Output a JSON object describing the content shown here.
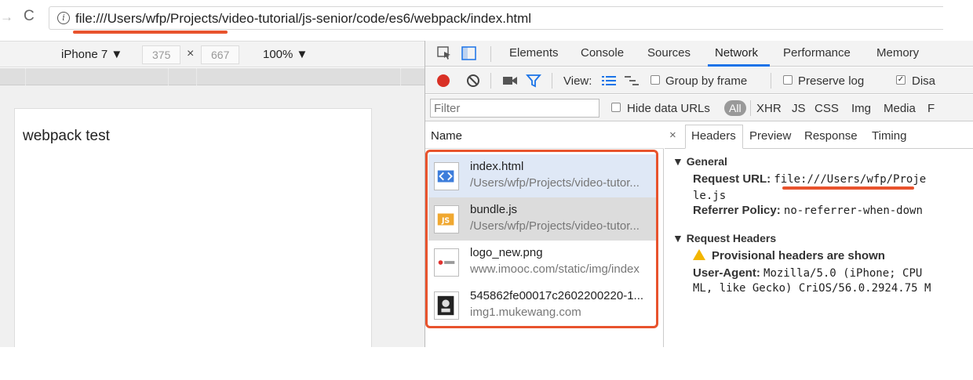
{
  "browser": {
    "back_arrow": "→",
    "reload_glyph": "C",
    "info_glyph": "i",
    "url": "file:///Users/wfp/Projects/video-tutorial/js-senior/code/es6/webpack/index.html"
  },
  "device_toolbar": {
    "device": "iPhone 7 ▼",
    "width": "375",
    "times": "×",
    "height": "667",
    "zoom": "100% ▼"
  },
  "page": {
    "content_text": "webpack test"
  },
  "devtools": {
    "tabs": [
      "Elements",
      "Console",
      "Sources",
      "Network",
      "Performance",
      "Memory"
    ],
    "active_tab": "Network",
    "toolbar": {
      "view_label": "View:",
      "group_by_frame": "Group by frame",
      "preserve_log": "Preserve log",
      "disable_cache": "Disa"
    },
    "filter": {
      "placeholder": "Filter",
      "hide_data_urls": "Hide data URLs",
      "types": [
        "All",
        "XHR",
        "JS",
        "CSS",
        "Img",
        "Media",
        "F"
      ]
    },
    "name_header": "Name",
    "requests": [
      {
        "name": "index.html",
        "path": "/Users/wfp/Projects/video-tutor...",
        "icon": "html-file-icon"
      },
      {
        "name": "bundle.js",
        "path": "/Users/wfp/Projects/video-tutor...",
        "icon": "js-file-icon"
      },
      {
        "name": "logo_new.png",
        "path": "www.imooc.com/static/img/index",
        "icon": "image-icon"
      },
      {
        "name": "545862fe00017c2602200220-1...",
        "path": "img1.mukewang.com",
        "icon": "image-icon"
      }
    ],
    "detail_tabs": [
      "Headers",
      "Preview",
      "Response",
      "Timing"
    ],
    "close_glyph": "×",
    "general": {
      "title": "▼ General",
      "request_url_label": "Request URL:",
      "request_url_value": "file:///Users/wfp/Proje",
      "request_url_wrap": "le.js",
      "referrer_label": "Referrer Policy:",
      "referrer_value": "no-referrer-when-down"
    },
    "request_headers": {
      "title": "▼ Request Headers",
      "warning": "Provisional headers are shown",
      "ua_label": "User-Agent:",
      "ua_value": "Mozilla/5.0 (iPhone; CPU",
      "ua_wrap": "ML, like Gecko) CriOS/56.0.2924.75 M"
    }
  },
  "colors": {
    "annotation": "#e8532d",
    "record": "#d93025",
    "active_tab_underline": "#1a73e8",
    "selected_row": "#dfe8f6",
    "hover_row": "#dcdcdc"
  }
}
